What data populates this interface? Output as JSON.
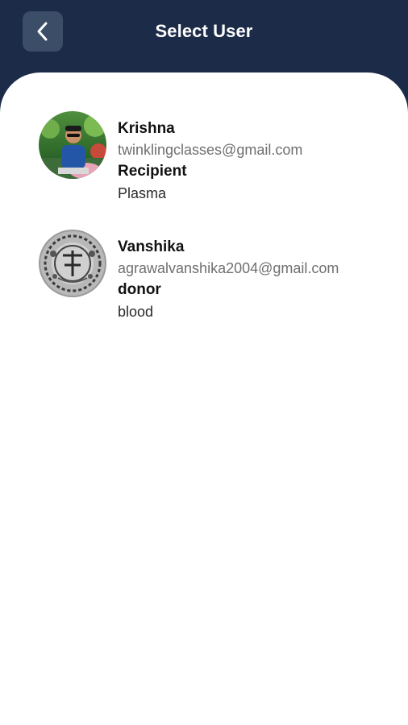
{
  "header": {
    "title": "Select User",
    "back_icon": "chevron-left-icon"
  },
  "users": [
    {
      "name": "Krishna",
      "email": "twinklingclasses@gmail.com",
      "role": "Recipient",
      "type": "Plasma",
      "avatar": "profile-photo"
    },
    {
      "name": "Vanshika",
      "email": "agrawalvanshika2004@gmail.com",
      "role": "donor",
      "type": "blood",
      "avatar": "profile-photo"
    }
  ],
  "colors": {
    "header_bg": "#1c2b48",
    "back_button_bg": "#3c4d68",
    "content_bg": "#ffffff"
  }
}
